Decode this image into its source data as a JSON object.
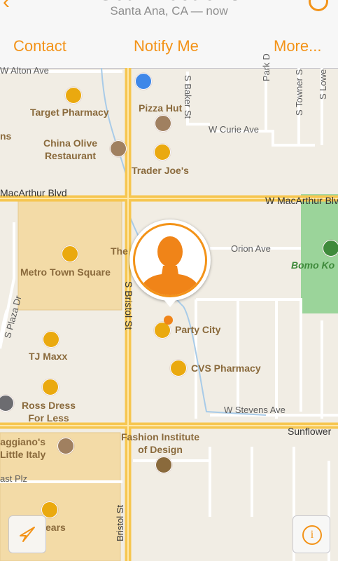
{
  "header": {
    "title": "Get Directions",
    "subtitle": "Santa Ana, CA — now"
  },
  "toolbar": {
    "contact": "Contact",
    "notify": "Notify Me",
    "more": "More..."
  },
  "map": {
    "streets": {
      "alton": "W Alton Ave",
      "baker": "S Baker St",
      "park": "Park D",
      "towner": "S Towner S",
      "lowe": "S Lowe",
      "curie": "W Curie Ave",
      "macarthur_left": "MacArthur Blvd",
      "macarthur_right": "W MacArthur Blvd",
      "orion": "Orion Ave",
      "bristol": "S Bristol St",
      "plaza": "S Plaza Dr",
      "stevens": "W Stevens Ave",
      "sunflower": "Sunflower",
      "last_plz": "ast Plz",
      "bristol2": "Bristol St"
    },
    "pois": {
      "target": "Target Pharmacy",
      "pizza": "Pizza Hut",
      "china_olive": "China Olive\nRestaurant",
      "trader": "Trader Joe's",
      "metro": "Metro Town Square",
      "the": "The",
      "party": "Party City",
      "tjmaxx": "TJ Maxx",
      "cvs": "CVS Pharmacy",
      "ross": "Ross Dress\nFor Less",
      "maggianos": "aggiano's\nLittle Italy",
      "fashion": "Fashion Institute\nof Design",
      "ns": "ns",
      "ears": "ears"
    },
    "park": "Bomo Ko",
    "colors": {
      "accent": "#f39318",
      "pin": "#eaa90f",
      "road": "#f6c650",
      "park": "#9bd49a",
      "mall": "#f3dba7"
    }
  },
  "controls": {
    "locate_icon": "location-arrow-icon",
    "info_icon": "info-icon",
    "info_glyph": "i"
  }
}
